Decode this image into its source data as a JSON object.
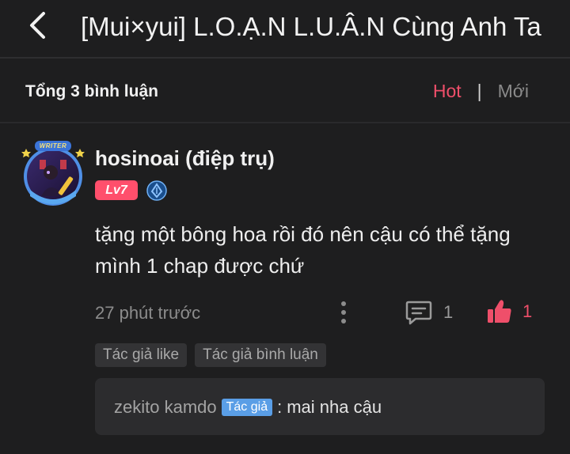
{
  "header": {
    "title": "[Mui×yui] L.O.Ạ.N L.U.Â.N Cùng Anh Ta"
  },
  "summary": {
    "total_label": "Tổng 3 bình luận",
    "sort_hot": "Hot",
    "sort_separator": "|",
    "sort_new": "Mới"
  },
  "comment": {
    "avatar_badge_text": "WRITER",
    "username": "hosinoai (điệp trụ)",
    "level": "Lv7",
    "text": "tặng một bông hoa rồi đó nên cậu có thể tặng mình 1 chap được chứ",
    "timestamp": "27 phút trước",
    "reply_count": "1",
    "like_count": "1",
    "tags": [
      "Tác giả like",
      "Tác giả bình luận"
    ]
  },
  "reply": {
    "user": "zekito kamdo",
    "author_badge": "Tác giả",
    "separator": ":",
    "text": "mai nha cậu"
  },
  "colors": {
    "background": "#1e1e1f",
    "accent": "#ef4f6a",
    "level_badge": "#ff4f6c",
    "author_badge": "#5a9ee6"
  },
  "icons": [
    "back-arrow-icon",
    "verified-badge-icon",
    "more-vertical-icon",
    "comment-icon",
    "thumbs-up-icon"
  ]
}
